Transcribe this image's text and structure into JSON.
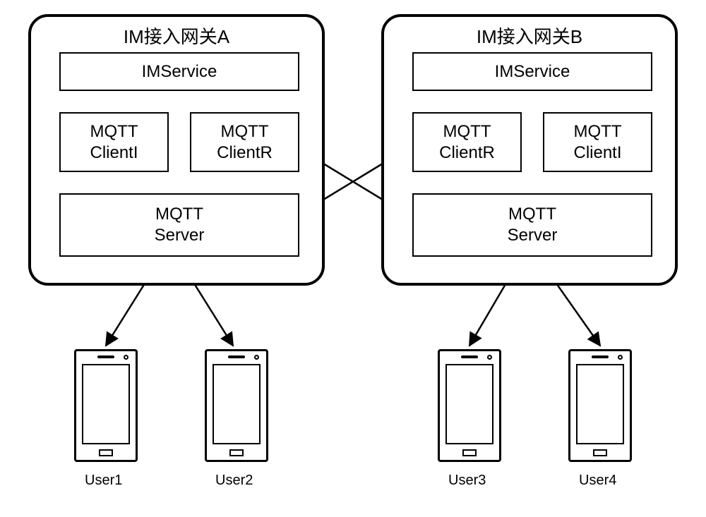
{
  "gatewayA": {
    "title": "IM接入网关A",
    "imservice": "IMService",
    "client_left": "MQTT\nClientI",
    "client_right": "MQTT\nClientR",
    "server": "MQTT\nServer"
  },
  "gatewayB": {
    "title": "IM接入网关B",
    "imservice": "IMService",
    "client_left": "MQTT\nClientR",
    "client_right": "MQTT\nClientI",
    "server": "MQTT\nServer"
  },
  "users": {
    "u1": "User1",
    "u2": "User2",
    "u3": "User3",
    "u4": "User4"
  }
}
